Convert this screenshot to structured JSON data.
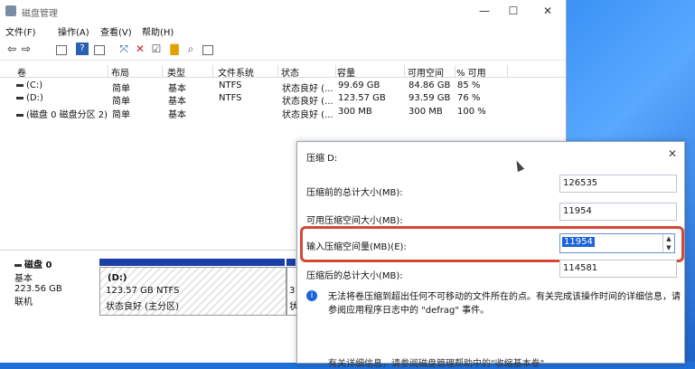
{
  "window": {
    "title": "磁盘管理",
    "controls": {
      "minimize": "—",
      "maximize": "☐",
      "close": "✕"
    }
  },
  "menu": [
    "文件(F)",
    "操作(A)",
    "查看(V)",
    "帮助(H)"
  ],
  "toolbar_icons": [
    "back-arrow-icon",
    "forward-arrow-icon",
    "grid-icon",
    "help-icon",
    "view-icon",
    "connect-icon",
    "delete-icon",
    "properties-icon",
    "folder-icon",
    "search-icon",
    "list-icon"
  ],
  "volumes": {
    "headers": [
      "卷",
      "布局",
      "类型",
      "文件系统",
      "状态",
      "容量",
      "可用空间",
      "% 可用"
    ],
    "rows": [
      [
        "(C:)",
        "简单",
        "基本",
        "NTFS",
        "状态良好 (...",
        "99.69 GB",
        "84.86 GB",
        "85 %"
      ],
      [
        "(D:)",
        "简单",
        "基本",
        "NTFS",
        "状态良好 (...",
        "123.57 GB",
        "93.59 GB",
        "76 %"
      ],
      [
        "(磁盘 0 磁盘分区 2)",
        "简单",
        "基本",
        "",
        "状态良好 (...",
        "300 MB",
        "300 MB",
        "100 %"
      ]
    ]
  },
  "disk": {
    "name": "磁盘 0",
    "type": "基本",
    "size": "223.56 GB",
    "status": "联机",
    "partition": {
      "name": "(D:)",
      "size": "123.57 GB NTFS",
      "status": "状态良好 (主分区)"
    },
    "partition2_label": "3",
    "partition2_status": "状"
  },
  "dialog": {
    "title": "压缩 D:",
    "close": "✕",
    "fields": {
      "total_before_label": "压缩前的总计大小(MB):",
      "total_before_value": "126535",
      "available_label": "可用压缩空间大小(MB):",
      "available_value": "11954",
      "input_label": "输入压缩空间量(MB)(E):",
      "input_value": "11954",
      "total_after_label": "压缩后的总计大小(MB):",
      "total_after_value": "114581"
    },
    "info": "无法将卷压缩到超出任何不可移动的文件所在的点。有关完成该操作时间的详细信息，请参阅应用程序日志中的 \"defrag\" 事件。",
    "footer": "有关详细信息，请参阅磁盘管理帮助中的\"收缩基本卷\""
  }
}
